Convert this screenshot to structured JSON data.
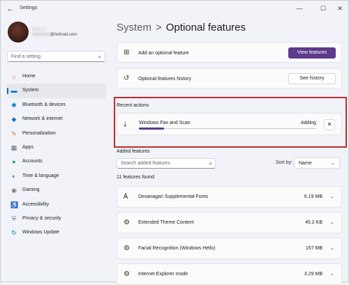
{
  "window": {
    "title": "Settings",
    "back_icon": "←",
    "minimize_icon": "—",
    "maximize_icon": "☐",
    "close_icon": "✕"
  },
  "profile": {
    "name": "Nick C",
    "email_hidden": "nickxxxxx",
    "email_domain": "@hotmail.com"
  },
  "sidebar": {
    "search_placeholder": "Find a setting",
    "items": [
      {
        "label": "Home",
        "icon": "⌂",
        "color": "#e06c2b"
      },
      {
        "label": "System",
        "icon": "▬",
        "color": "#0078d4"
      },
      {
        "label": "Bluetooth & devices",
        "icon": "✱",
        "color": "#0078d4"
      },
      {
        "label": "Network & internet",
        "icon": "◆",
        "color": "#1a6fc9"
      },
      {
        "label": "Personalization",
        "icon": "✎",
        "color": "#d4762b"
      },
      {
        "label": "Apps",
        "icon": "▦",
        "color": "#5b6473"
      },
      {
        "label": "Accounts",
        "icon": "●",
        "color": "#2aa05a"
      },
      {
        "label": "Time & language",
        "icon": "◐",
        "color": "#1f6fc1"
      },
      {
        "label": "Gaming",
        "icon": "◉",
        "color": "#6b7280"
      },
      {
        "label": "Accessibility",
        "icon": "♿",
        "color": "#1f6fc1"
      },
      {
        "label": "Privacy & security",
        "icon": "⛨",
        "color": "#6b7280"
      },
      {
        "label": "Windows Update",
        "icon": "↻",
        "color": "#0078d4"
      }
    ],
    "active_index": 1
  },
  "header": {
    "parent": "System",
    "separator": ">",
    "current": "Optional features"
  },
  "add_feature": {
    "label": "Add an optional feature",
    "button": "View features"
  },
  "history": {
    "label": "Optional features history",
    "button": "See history"
  },
  "recent": {
    "section_label": "Recent actions",
    "item_name": "Windows Fax and Scan",
    "status": "Adding",
    "progress_fraction": 0.14
  },
  "added": {
    "section_label": "Added features",
    "search_placeholder": "Search added features",
    "sort_label": "Sort by:",
    "sort_value": "Name",
    "count_text": "11 features found",
    "features": [
      {
        "name": "Devanagari Supplemental Fonts",
        "size": "6.19 MB",
        "icon": "Ꭺ"
      },
      {
        "name": "Extended Theme Content",
        "size": "45.2 KB",
        "icon": "⚙"
      },
      {
        "name": "Facial Recognition (Windows Hello)",
        "size": "157 MB",
        "icon": "⚙"
      },
      {
        "name": "Internet Explorer mode",
        "size": "3.29 MB",
        "icon": "⚙"
      }
    ]
  },
  "colors": {
    "accent": "#5d3a8c",
    "highlight_border": "#c6292d",
    "nav_indicator": "#0067c0"
  }
}
